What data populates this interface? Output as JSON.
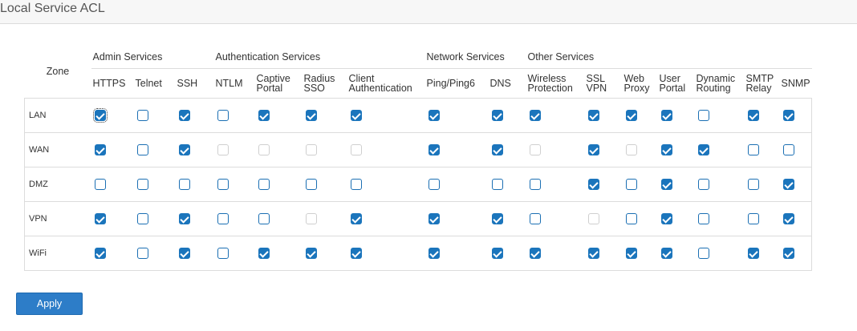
{
  "page": {
    "title": "Local Service ACL"
  },
  "table": {
    "zone_header": "Zone",
    "groups": [
      {
        "label": "Admin Services",
        "span": 3
      },
      {
        "label": "Authentication Services",
        "span": 4
      },
      {
        "label": "Network Services",
        "span": 2
      },
      {
        "label": "Other Services",
        "span": 8
      }
    ],
    "services": [
      [
        "HTTPS"
      ],
      [
        "Telnet"
      ],
      [
        "SSH"
      ],
      [
        "NTLM"
      ],
      [
        "Captive",
        "Portal"
      ],
      [
        "Radius",
        "SSO"
      ],
      [
        "Client",
        "Authentication"
      ],
      [
        "Ping/Ping6"
      ],
      [
        "DNS"
      ],
      [
        "Wireless",
        "Protection"
      ],
      [
        "SSL",
        "VPN"
      ],
      [
        "Web",
        "Proxy"
      ],
      [
        "User",
        "Portal"
      ],
      [
        "Dynamic",
        "Routing"
      ],
      [
        "SMTP",
        "Relay"
      ],
      [
        "SNMP"
      ]
    ],
    "rows": [
      {
        "zone": "LAN",
        "states": [
          "on",
          "off",
          "on",
          "off",
          "on",
          "on",
          "on",
          "on",
          "on",
          "on",
          "on",
          "on",
          "on",
          "off",
          "on",
          "on"
        ]
      },
      {
        "zone": "WAN",
        "states": [
          "on",
          "off",
          "on",
          "dis",
          "dis",
          "dis",
          "dis",
          "on",
          "on",
          "dis",
          "on",
          "dis",
          "on",
          "on",
          "off",
          "off"
        ]
      },
      {
        "zone": "DMZ",
        "states": [
          "off",
          "off",
          "off",
          "off",
          "off",
          "off",
          "off",
          "off",
          "off",
          "off",
          "on",
          "off",
          "on",
          "off",
          "off",
          "on"
        ]
      },
      {
        "zone": "VPN",
        "states": [
          "on",
          "off",
          "on",
          "off",
          "off",
          "dis",
          "on",
          "on",
          "on",
          "off",
          "dis",
          "off",
          "on",
          "off",
          "off",
          "on"
        ]
      },
      {
        "zone": "WiFi",
        "states": [
          "on",
          "off",
          "on",
          "off",
          "on",
          "on",
          "on",
          "on",
          "on",
          "on",
          "on",
          "on",
          "on",
          "off",
          "on",
          "on"
        ]
      }
    ]
  },
  "actions": {
    "apply_label": "Apply"
  },
  "colors": {
    "accent": "#1b75bc",
    "button": "#2d7dc8",
    "border": "#dcdcdc",
    "disabled": "#cfcfcf"
  }
}
